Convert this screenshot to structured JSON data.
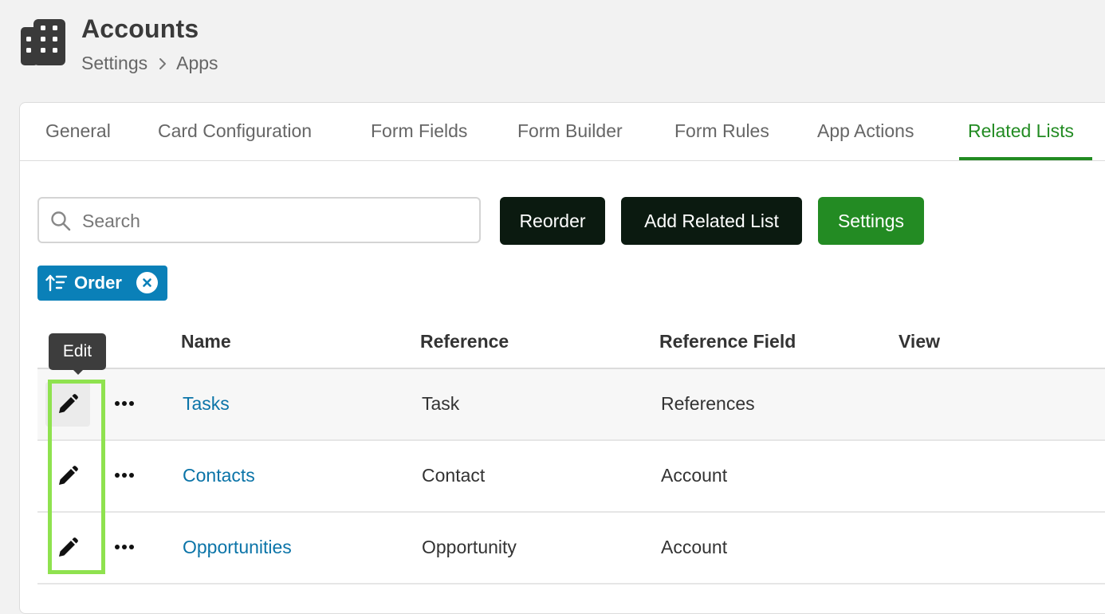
{
  "header": {
    "icon": "building-icon",
    "title": "Accounts",
    "breadcrumb": [
      "Settings",
      "Apps"
    ]
  },
  "tabs": [
    {
      "label": "General",
      "active": false
    },
    {
      "label": "Card Configuration",
      "active": false
    },
    {
      "label": "Form Fields",
      "active": false
    },
    {
      "label": "Form Builder",
      "active": false
    },
    {
      "label": "Form Rules",
      "active": false
    },
    {
      "label": "App Actions",
      "active": false
    },
    {
      "label": "Related Lists",
      "active": true
    }
  ],
  "toolbar": {
    "search_placeholder": "Search",
    "search_value": "",
    "reorder_label": "Reorder",
    "add_related_list_label": "Add Related List",
    "settings_label": "Settings"
  },
  "filter_chip": {
    "label": "Order",
    "icon": "sort-ascending-icon"
  },
  "table": {
    "columns": [
      "Name",
      "Reference",
      "Reference Field",
      "View"
    ],
    "rows": [
      {
        "name": "Tasks",
        "reference": "Task",
        "reference_field": "References",
        "view": ""
      },
      {
        "name": "Contacts",
        "reference": "Contact",
        "reference_field": "Account",
        "view": ""
      },
      {
        "name": "Opportunities",
        "reference": "Opportunity",
        "reference_field": "Account",
        "view": ""
      }
    ]
  },
  "tooltip": {
    "text": "Edit"
  },
  "colors": {
    "accent_green": "#238b23",
    "dark_button": "#0b1a10",
    "chip_blue": "#0a80b8",
    "link_blue": "#0b74a8",
    "highlight": "#8fe24f"
  }
}
